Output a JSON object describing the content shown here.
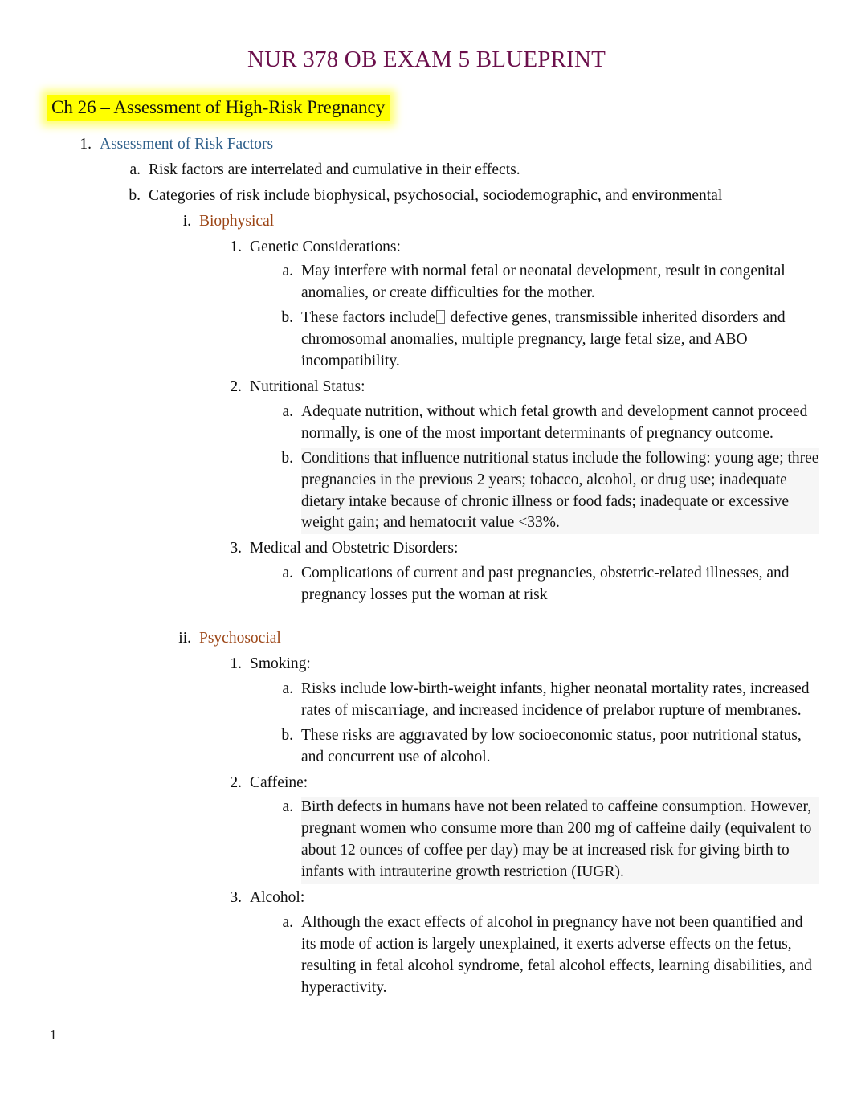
{
  "document": {
    "title": "NUR 378 OB EXAM 5 BLUEPRINT",
    "chapter_heading": "Ch 26 – Assessment of High-Risk Pregnancy",
    "page_number": "1",
    "colors": {
      "title": "#6B0F4B",
      "highlight": "#FFFF00",
      "level1_blue": "#2E5F8A",
      "level3_brown": "#9C4617",
      "body": "#111111",
      "shading": "#F0F0F0"
    }
  },
  "outline": {
    "item1": {
      "marker": "1.",
      "text": "Assessment of Risk Factors"
    },
    "item1a": {
      "marker": "a.",
      "text": "Risk factors are interrelated and cumulative in their effects."
    },
    "item1b": {
      "marker": "b.",
      "text": "Categories of risk include biophysical, psychosocial, sociodemographic, and environmental"
    },
    "biophysical": {
      "marker": "i.",
      "text": "Biophysical"
    },
    "genetic": {
      "marker": "1.",
      "text": "Genetic Considerations:"
    },
    "genetic_a": {
      "marker": "a.",
      "text": "May interfere with normal fetal or neonatal development, result in congenital anomalies, or create difficulties for the mother."
    },
    "genetic_b": {
      "marker": "b.",
      "text_before": "These factors include",
      "text_after": "defective genes, transmissible inherited disorders and chromosomal anomalies, multiple pregnancy, large fetal size, and ABO incompatibility.",
      "special_glyph": "missing-glyph-box"
    },
    "nutritional": {
      "marker": "2.",
      "text": "Nutritional Status:"
    },
    "nutritional_a": {
      "marker": "a.",
      "text": "Adequate nutrition, without which fetal growth and development cannot proceed normally, is one of the most important determinants of pregnancy outcome."
    },
    "nutritional_b": {
      "marker": "b.",
      "text": "Conditions that influence nutritional status include the following: young age; three pregnancies in the previous 2 years; tobacco, alcohol, or drug use; inadequate dietary intake because of chronic illness or food fads; inadequate or excessive weight gain; and hematocrit value <33%."
    },
    "medical": {
      "marker": "3.",
      "text": "Medical and Obstetric Disorders:"
    },
    "medical_a": {
      "marker": "a.",
      "text": "Complications of current and past pregnancies, obstetric-related illnesses, and pregnancy losses put the woman at risk"
    },
    "psychosocial": {
      "marker": "ii.",
      "text": "Psychosocial"
    },
    "smoking": {
      "marker": "1.",
      "text": "Smoking:"
    },
    "smoking_a": {
      "marker": "a.",
      "text": "Risks include low-birth-weight infants, higher neonatal mortality rates, increased rates of miscarriage, and increased incidence of prelabor rupture of membranes."
    },
    "smoking_b": {
      "marker": "b.",
      "text": "These risks are aggravated by low socioeconomic status, poor nutritional status, and concurrent use of alcohol."
    },
    "caffeine": {
      "marker": "2.",
      "text": "Caffeine:"
    },
    "caffeine_a": {
      "marker": "a.",
      "text": "Birth defects in humans have not been related to caffeine consumption. However, pregnant women who consume more than 200 mg of caffeine daily (equivalent to about 12 ounces of coffee per day) may be at increased risk for giving birth to infants with intrauterine growth restriction (IUGR)."
    },
    "alcohol": {
      "marker": "3.",
      "text": "Alcohol:"
    },
    "alcohol_a": {
      "marker": "a.",
      "text": "Although the exact effects of alcohol in pregnancy have not been quantified and its mode of action is largely unexplained, it exerts adverse effects on the fetus, resulting in fetal alcohol syndrome, fetal alcohol effects, learning disabilities, and hyperactivity."
    }
  }
}
